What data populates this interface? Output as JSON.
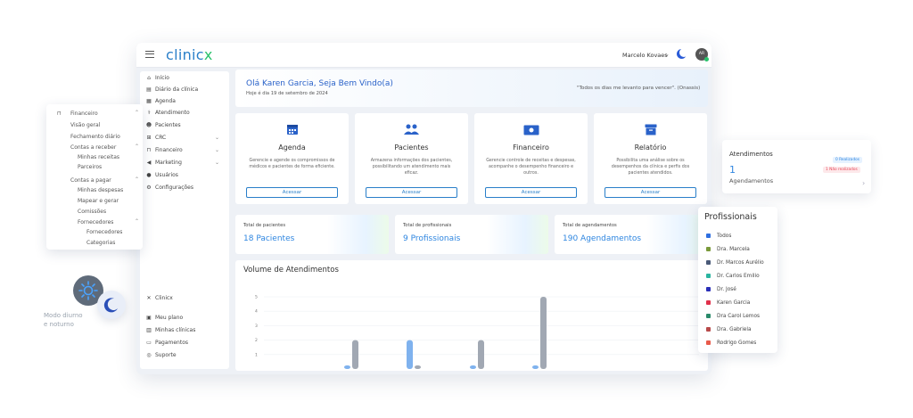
{
  "app": {
    "logo_main": "clinic",
    "logo_accent": "x",
    "user_name": "Marcelo Kovaes",
    "avatar_initials": "AR"
  },
  "sidebar": {
    "items": [
      {
        "label": "Início",
        "icon": "home-icon"
      },
      {
        "label": "Diário da clínica",
        "icon": "book-icon"
      },
      {
        "label": "Agenda",
        "icon": "calendar-icon"
      },
      {
        "label": "Atendimento",
        "icon": "stethoscope-icon"
      },
      {
        "label": "Pacientes",
        "icon": "users-icon"
      },
      {
        "label": "CRC",
        "icon": "crc-icon"
      },
      {
        "label": "Financeiro",
        "icon": "bank-icon"
      },
      {
        "label": "Marketing",
        "icon": "megaphone-icon"
      },
      {
        "label": "Usuários",
        "icon": "user-icon"
      },
      {
        "label": "Configurações",
        "icon": "gear-icon"
      }
    ],
    "bottom_items": [
      {
        "label": "Clinicx",
        "icon": "clinicx-icon"
      },
      {
        "label": "Meu plano",
        "icon": "plan-icon"
      },
      {
        "label": "Minhas clínicas",
        "icon": "clinics-icon"
      },
      {
        "label": "Pagamentos",
        "icon": "card-icon"
      },
      {
        "label": "Suporte",
        "icon": "support-icon"
      }
    ]
  },
  "welcome": {
    "title": "Olá Karen Garcia, Seja Bem Vindo(a)",
    "date": "Hoje é dia 19 de setembro de 2024",
    "quote": "\"Todos os dias me levanto para vencer\". (Onassis)"
  },
  "cards": [
    {
      "title": "Agenda",
      "desc": "Gerencie e agende os compromissos de médicos e pacientes de forma eficiente.",
      "button": "Acessar",
      "icon": "calendar-icon"
    },
    {
      "title": "Pacientes",
      "desc": "Armazena informações dos pacientes, possibilitando um atendimento mais eficaz.",
      "button": "Acessar",
      "icon": "users-icon"
    },
    {
      "title": "Financeiro",
      "desc": "Gerencie controle de receitas e despesas, acompanhe o desempenho financeiro e outros.",
      "button": "Acessar",
      "icon": "money-icon"
    },
    {
      "title": "Relatório",
      "desc": "Possibilita uma análise sobre os desempenhos da clínica e perfis dos pacientes atendidos.",
      "button": "Acessar",
      "icon": "archive-icon"
    }
  ],
  "stats": [
    {
      "label": "Total de pacientes",
      "value": "18 Pacientes"
    },
    {
      "label": "Total de profissionais",
      "value": "9 Profissionais"
    },
    {
      "label": "Total de agendamentos",
      "value": "190 Agendamentos"
    }
  ],
  "finance_menu": {
    "items": [
      {
        "label": "Financeiro",
        "level": 0
      },
      {
        "label": "Visão geral",
        "level": 1
      },
      {
        "label": "Fechamento diário",
        "level": 1
      },
      {
        "label": "Contas a receber",
        "level": 1
      },
      {
        "label": "Minhas receitas",
        "level": 2
      },
      {
        "label": "Parceiros",
        "level": 2
      },
      {
        "label": "Contas a pagar",
        "level": 1
      },
      {
        "label": "Minhas despesas",
        "level": 2
      },
      {
        "label": "Mapear e gerar",
        "level": 2
      },
      {
        "label": "Comissões",
        "level": 2
      },
      {
        "label": "Fornecedores",
        "level": 2
      },
      {
        "label": "Fornecedores",
        "level": 3
      },
      {
        "label": "Categorias",
        "level": 3
      }
    ]
  },
  "atendimentos": {
    "title": "Atendimentos",
    "count": "1",
    "subtitle": "Agendamentos",
    "badge_done": "0 Realizados",
    "badge_not_done": "1 Não realizados"
  },
  "profissionais": {
    "title": "Profissionais",
    "items": [
      {
        "name": "Todos",
        "color": "#2f6fe0"
      },
      {
        "name": "Dra. Marcela",
        "color": "#7a9a3a"
      },
      {
        "name": "Dr. Marcos Aurélio",
        "color": "#4a5a78"
      },
      {
        "name": "Dr. Carlos Emilio",
        "color": "#2bb5a0"
      },
      {
        "name": "Dr. José",
        "color": "#2a2fb8"
      },
      {
        "name": "Karen Garcia",
        "color": "#e0304a"
      },
      {
        "name": "Dra Carol Lemos",
        "color": "#2a8a6a"
      },
      {
        "name": "Dra. Gabriela",
        "color": "#b84a4a"
      },
      {
        "name": "Rodrigo Gomes",
        "color": "#e85a4a"
      }
    ]
  },
  "mode": {
    "label_line1": "Modo diurno",
    "label_line2": "e noturno"
  },
  "chart_data": {
    "type": "bar",
    "title": "Volume de Atendimentos",
    "y_ticks": [
      "1",
      "2",
      "3",
      "4",
      "5"
    ],
    "ylim": [
      0,
      5
    ],
    "groups": [
      {
        "values": [
          0,
          2
        ]
      },
      {
        "values": [
          2,
          0
        ]
      },
      {
        "values": [
          0,
          2
        ]
      },
      {
        "values": [
          0,
          5
        ]
      }
    ],
    "colors": [
      "#7fb2ee",
      "#a1a8b3"
    ]
  }
}
